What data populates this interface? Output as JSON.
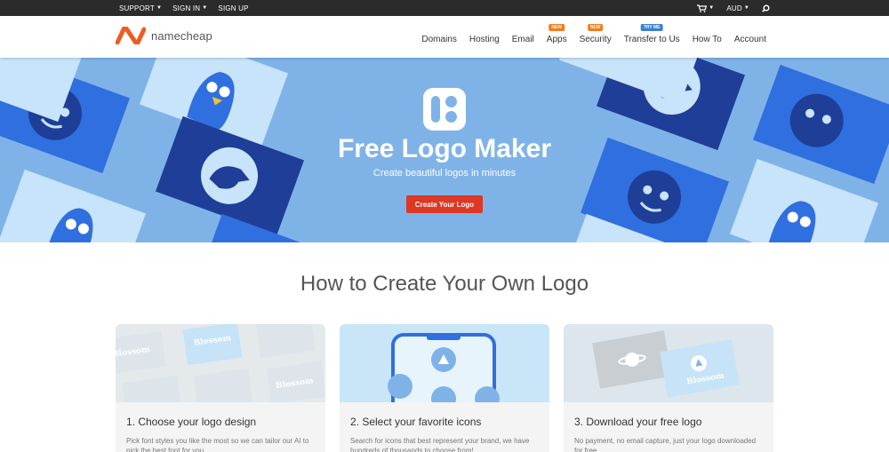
{
  "topbar": {
    "support": "SUPPORT",
    "sign_in": "SIGN IN",
    "sign_up": "SIGN UP",
    "currency": "AUD"
  },
  "header": {
    "brand": "namecheap",
    "nav": [
      {
        "label": "Domains",
        "badge": ""
      },
      {
        "label": "Hosting",
        "badge": ""
      },
      {
        "label": "Email",
        "badge": ""
      },
      {
        "label": "Apps",
        "badge": "NEW"
      },
      {
        "label": "Security",
        "badge": "NEW"
      },
      {
        "label": "Transfer to Us",
        "badge": "TRY ME"
      },
      {
        "label": "How To",
        "badge": ""
      },
      {
        "label": "Account",
        "badge": ""
      }
    ]
  },
  "hero": {
    "title": "Free Logo Maker",
    "subtitle": "Create beautiful logos in minutes",
    "cta": "Create Your Logo"
  },
  "section": {
    "title": "How to Create Your Own Logo",
    "steps": [
      {
        "title": "1. Choose your logo design",
        "desc": "Pick font styles you like the most so we can tailor our AI to pick the best font for you."
      },
      {
        "title": "2. Select your favorite icons",
        "desc": "Search for icons that best represent your brand, we have hundreds of thousands to choose from!"
      },
      {
        "title": "3. Download your free logo",
        "desc": "No payment, no email capture, just your logo downloaded for free."
      }
    ],
    "sample_word": "Blossom"
  },
  "colors": {
    "topbar": "#2b2b2b",
    "hero_bg": "#7fb3e8",
    "card_royal": "#2f6fe0",
    "card_navy": "#1f3e97",
    "card_pale": "#c7e4fa",
    "cta": "#de3723",
    "brand_orange": "#f15a22"
  }
}
